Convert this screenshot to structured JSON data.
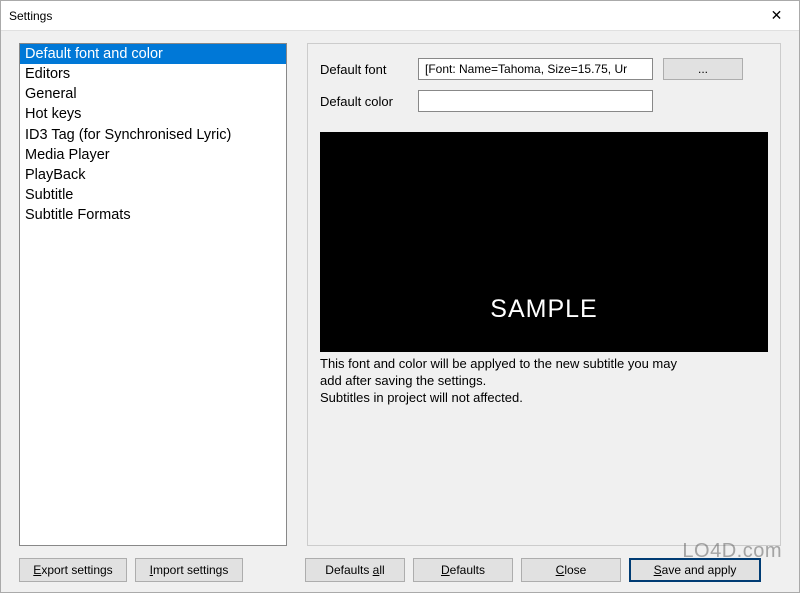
{
  "window": {
    "title": "Settings",
    "close_icon": "✕"
  },
  "sidebar": {
    "items": [
      {
        "label": "Default font and color",
        "selected": true
      },
      {
        "label": "Editors",
        "selected": false
      },
      {
        "label": "General",
        "selected": false
      },
      {
        "label": "Hot keys",
        "selected": false
      },
      {
        "label": "ID3 Tag (for Synchronised Lyric)",
        "selected": false
      },
      {
        "label": "Media Player",
        "selected": false
      },
      {
        "label": "PlayBack",
        "selected": false
      },
      {
        "label": "Subtitle",
        "selected": false
      },
      {
        "label": "Subtitle Formats",
        "selected": false
      }
    ]
  },
  "panel": {
    "font_label": "Default font",
    "font_value": "[Font: Name=Tahoma, Size=15.75, Ur",
    "font_button": "...",
    "color_label": "Default color",
    "color_value": "",
    "preview_text": "SAMPLE",
    "hint_line1": "This font and color will be applyed to the new subtitle you may",
    "hint_line2": "add after saving the settings.",
    "hint_line3": "Subtitles in project will not affected."
  },
  "buttons": {
    "export": {
      "pre": "",
      "u": "E",
      "post": "xport settings"
    },
    "import": {
      "pre": "",
      "u": "I",
      "post": "mport settings"
    },
    "defaults_all": {
      "pre": "Defaults ",
      "u": "a",
      "post": "ll"
    },
    "defaults": {
      "pre": "",
      "u": "D",
      "post": "efaults"
    },
    "close": {
      "pre": "",
      "u": "C",
      "post": "lose"
    },
    "save": {
      "pre": "",
      "u": "S",
      "post": "ave and apply"
    }
  },
  "watermark": "LO4D.com"
}
